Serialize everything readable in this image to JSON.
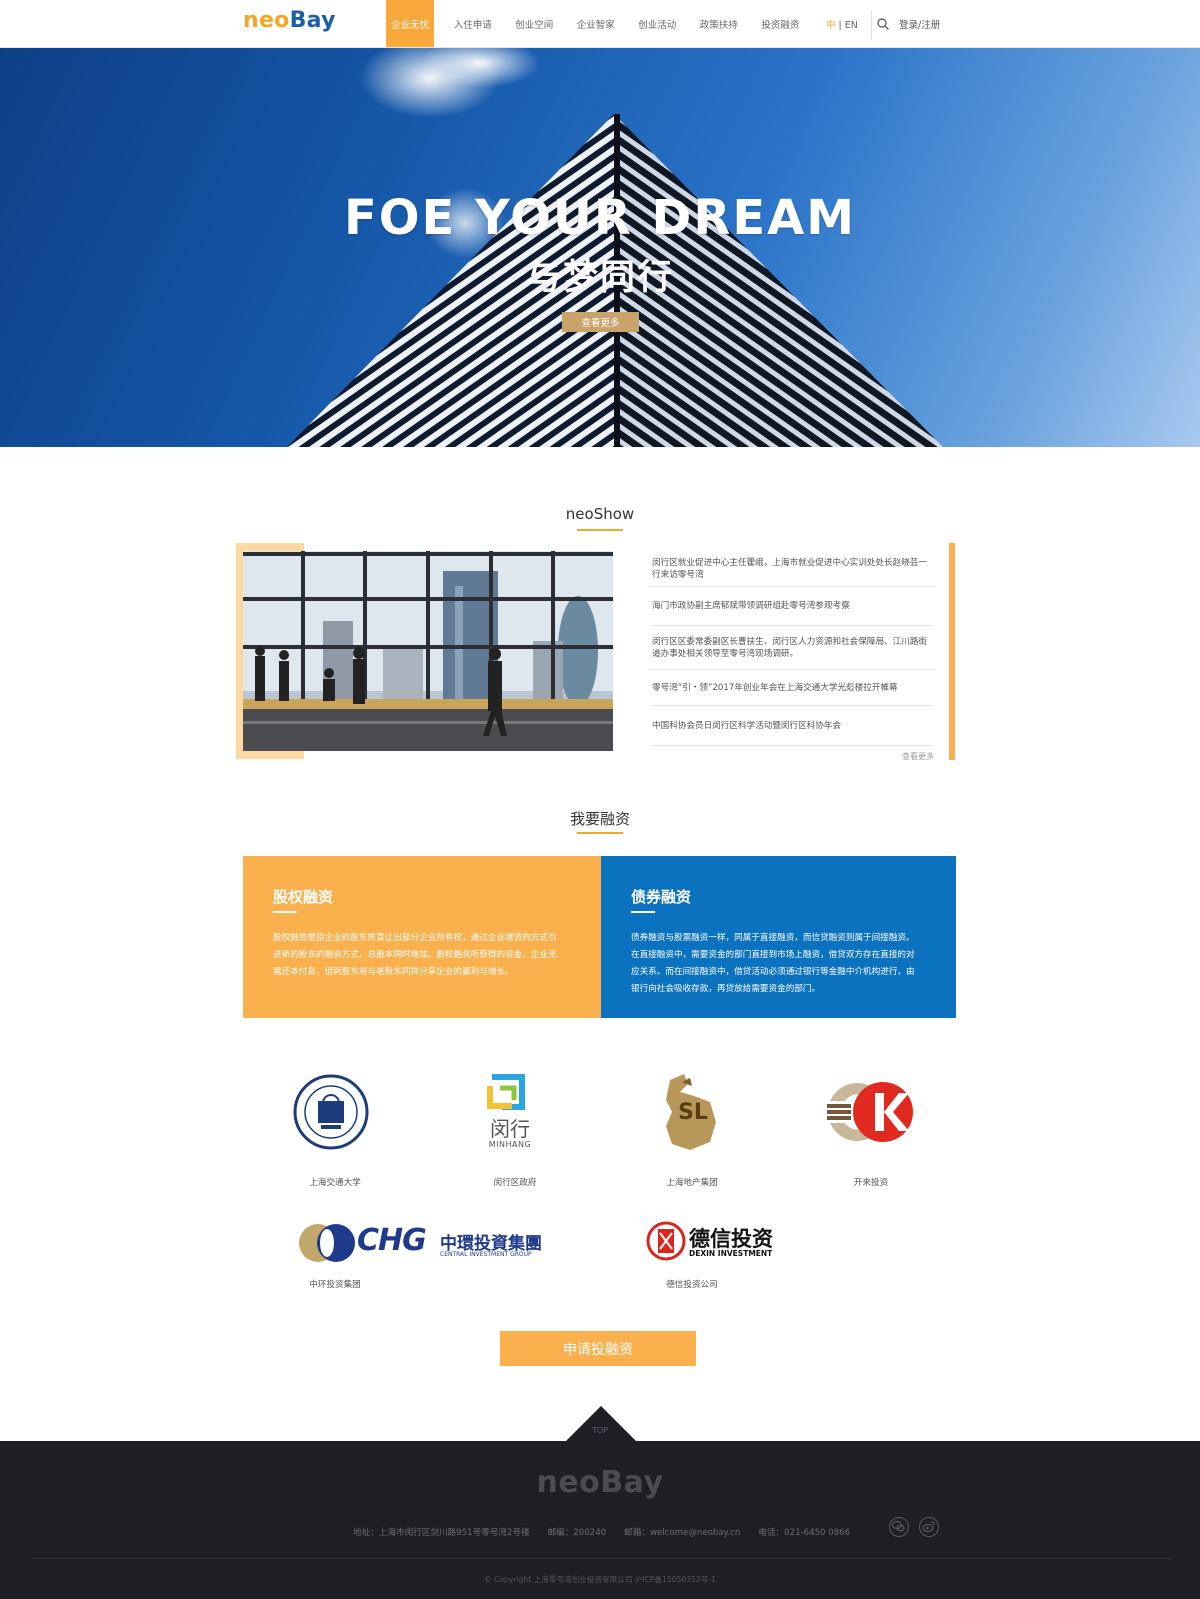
{
  "header": {
    "logo_neo": "neo",
    "logo_bay": "Bay",
    "nav": [
      "企业无忧",
      "入住申请",
      "创业空间",
      "企业智家",
      "创业活动",
      "政策扶持",
      "投资融资"
    ],
    "lang_zh": "中",
    "lang_sep": " | ",
    "lang_en": "EN",
    "login": "登录/注册"
  },
  "hero": {
    "title": "FOE YOUR DREAM",
    "subtitle": "与梦同行",
    "button": "查看更多"
  },
  "show": {
    "title": "neoShow",
    "news": [
      "闵行区就业促进中心主任瞿峨，上海市就业促进中心实训处处长赵晓芸一行来访零号湾",
      "海门市政协副主席郁斌带领调研组赴零号湾参观考察",
      "闵行区区委常委副区长曹扶生、闵行区人力资源和社会保障局、江川路街道办事处相关领导至零号湾现场调研。",
      "零号湾“引・领”2017年创业年会在上海交通大学光彪楼拉开帷幕",
      "中国科协会员日闵行区科学活动暨闵行区科协年会"
    ],
    "more": "查看更多"
  },
  "financing": {
    "title": "我要融资",
    "equity_title": "股权融资",
    "equity_text": [
      "股权融资是指企业的股东愿意让出部分企业所有权，通过企业增资的方式引",
      "进新的股东的融资方式，总股本同时增加。股权融资所获得的资金，企业无",
      "需还本付息，但新股东将与老股东同样分享企业的赢利与增长。"
    ],
    "bond_title": "债券融资",
    "bond_text": [
      "债券融资与股票融资一样，同属于直接融资，而信贷融资则属于间接融资。",
      "在直接融资中，需要资金的部门直接到市场上融资，借贷双方存在直接的对",
      "应关系。而在间接融资中，借贷活动必须通过银行等金融中介机构进行，由",
      "银行向社会吸收存款，再贷放给需要资金的部门。"
    ]
  },
  "partners": {
    "items": [
      "上海交通大学",
      "闵行区政府",
      "上海地产集团",
      "开来投资",
      "中环投资集团",
      "德信投资公司"
    ],
    "minhang_cn": "闵行",
    "minhang_en": "MINHANG",
    "sl": "SL",
    "chg": "CHG",
    "chg_cn": "中環投資集團",
    "chg_en": "CENTRAL INVESTMENT GROUP",
    "dexin_cn": "德信投资",
    "dexin_en": "DEXIN INVESTMENT"
  },
  "apply_button": "申请投融资",
  "footer": {
    "top": "TOP",
    "logo": "neoBay",
    "address": "地址：上海市闵行区剑川路951号零号湾2号楼",
    "postcode": "邮编：200240",
    "email": "邮箱：welcome@neobay.cn",
    "phone": "电话：021-6450 0866",
    "copyright": "© Copyright 上海零号湾创业投资有限公司 沪ICP备15050352号-1"
  },
  "colors": {
    "accent": "#f9b04d",
    "blue": "#0b72c0",
    "footer": "#1d1f24"
  }
}
